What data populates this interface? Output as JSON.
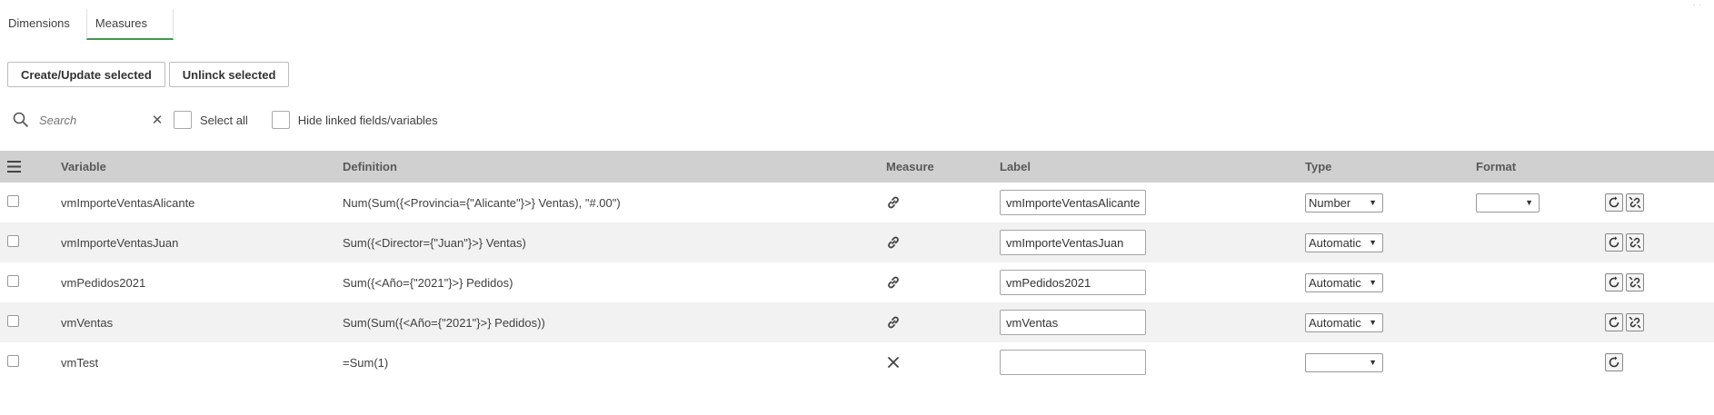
{
  "tabs": [
    {
      "label": "Dimensions",
      "active": false
    },
    {
      "label": "Measures",
      "active": true
    }
  ],
  "buttons": {
    "create_update": "Create/Update selected",
    "unlink": "Unlinck selected"
  },
  "search": {
    "placeholder": "Search",
    "select_all_label": "Select all",
    "hide_linked_label": "Hide linked fields/variables"
  },
  "table": {
    "columns": [
      "Variable",
      "Definition",
      "Measure",
      "Label",
      "Type",
      "Format"
    ],
    "rows": [
      {
        "variable": "vmImporteVentasAlicante",
        "definition": "Num(Sum({<Provincia={\"Alicante\"}>} Ventas), \"#.00\")",
        "measure": "linked",
        "label": "vmImporteVentasAlicante",
        "type": "Number",
        "format": ""
      },
      {
        "variable": "vmImporteVentasJuan",
        "definition": "Sum({<Director={\"Juan\"}>} Ventas)",
        "measure": "linked",
        "label": "vmImporteVentasJuan",
        "type": "Automatic",
        "format": ""
      },
      {
        "variable": "vmPedidos2021",
        "definition": "Sum({<Año={\"2021\"}>} Pedidos)",
        "measure": "linked",
        "label": "vmPedidos2021",
        "type": "Automatic",
        "format": ""
      },
      {
        "variable": "vmVentas",
        "definition": "Sum(Sum({<Año={\"2021\"}>} Pedidos))",
        "measure": "linked",
        "label": "vmVentas",
        "type": "Automatic",
        "format": ""
      },
      {
        "variable": "vmTest",
        "definition": "=Sum(1)",
        "measure": "not-linked",
        "label": "",
        "type": "",
        "format": ""
      }
    ]
  },
  "icons": {
    "search": "search-icon",
    "clear": "close-icon",
    "menu": "hamburger-menu-icon",
    "linked": "link-icon",
    "not_linked": "close-icon",
    "refresh": "refresh-icon",
    "unlink": "unlink-icon"
  },
  "colors": {
    "accent": "#3e9a48",
    "header_bg": "#d0d0d0",
    "row_alt_bg": "#f2f2f2"
  }
}
